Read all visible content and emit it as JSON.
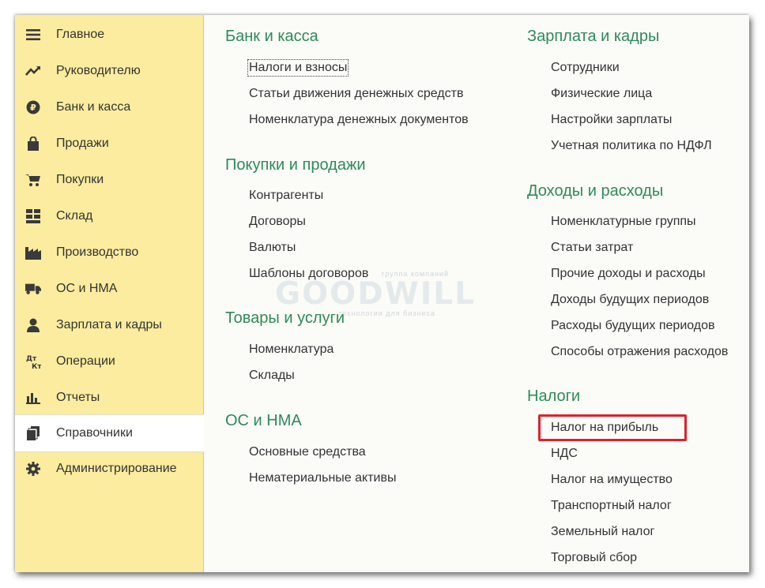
{
  "sidebar": {
    "items": [
      {
        "label": "Главное",
        "icon": "menu-lines-icon"
      },
      {
        "label": "Руководителю",
        "icon": "trend-chart-icon"
      },
      {
        "label": "Банк и касса",
        "icon": "ruble-coin-icon"
      },
      {
        "label": "Продажи",
        "icon": "shopping-bag-icon"
      },
      {
        "label": "Покупки",
        "icon": "shopping-cart-icon"
      },
      {
        "label": "Склад",
        "icon": "warehouse-grid-icon"
      },
      {
        "label": "Производство",
        "icon": "factory-icon"
      },
      {
        "label": "ОС и НМА",
        "icon": "truck-icon"
      },
      {
        "label": "Зарплата и кадры",
        "icon": "person-icon"
      },
      {
        "label": "Операции",
        "icon": "debit-credit-icon"
      },
      {
        "label": "Отчеты",
        "icon": "bar-chart-icon"
      },
      {
        "label": "Справочники",
        "icon": "documents-icon"
      },
      {
        "label": "Администрирование",
        "icon": "gear-icon"
      }
    ],
    "active_index": 11
  },
  "sections": {
    "bank": {
      "title": "Банк и касса",
      "links": [
        "Налоги и взносы",
        "Статьи движения денежных средств",
        "Номенклатура денежных документов"
      ]
    },
    "purchases_sales": {
      "title": "Покупки и продажи",
      "links": [
        "Контрагенты",
        "Договоры",
        "Валюты",
        "Шаблоны договоров"
      ]
    },
    "goods": {
      "title": "Товары и услуги",
      "links": [
        "Номенклатура",
        "Склады"
      ]
    },
    "fixed_assets": {
      "title": "ОС и НМА",
      "links": [
        "Основные средства",
        "Нематериальные активы"
      ]
    },
    "salary": {
      "title": "Зарплата и кадры",
      "links": [
        "Сотрудники",
        "Физические лица",
        "Настройки зарплаты",
        "Учетная политика по НДФЛ"
      ]
    },
    "income_expense": {
      "title": "Доходы и расходы",
      "links": [
        "Номенклатурные группы",
        "Статьи затрат",
        "Прочие доходы и расходы",
        "Доходы будущих периодов",
        "Расходы будущих периодов",
        "Способы отражения расходов"
      ]
    },
    "taxes": {
      "title": "Налоги",
      "links": [
        "Налог на прибыль",
        "НДС",
        "Налог на имущество",
        "Транспортный налог",
        "Земельный налог",
        "Торговый сбор"
      ]
    }
  },
  "watermark": {
    "brand": "GOODWILL",
    "top_line": "группа компаний",
    "bottom_line": "технологии для бизнеса"
  },
  "colors": {
    "sidebar_bg": "#fbec9f",
    "section_title": "#2e8b57",
    "highlight": "#e0202c"
  }
}
